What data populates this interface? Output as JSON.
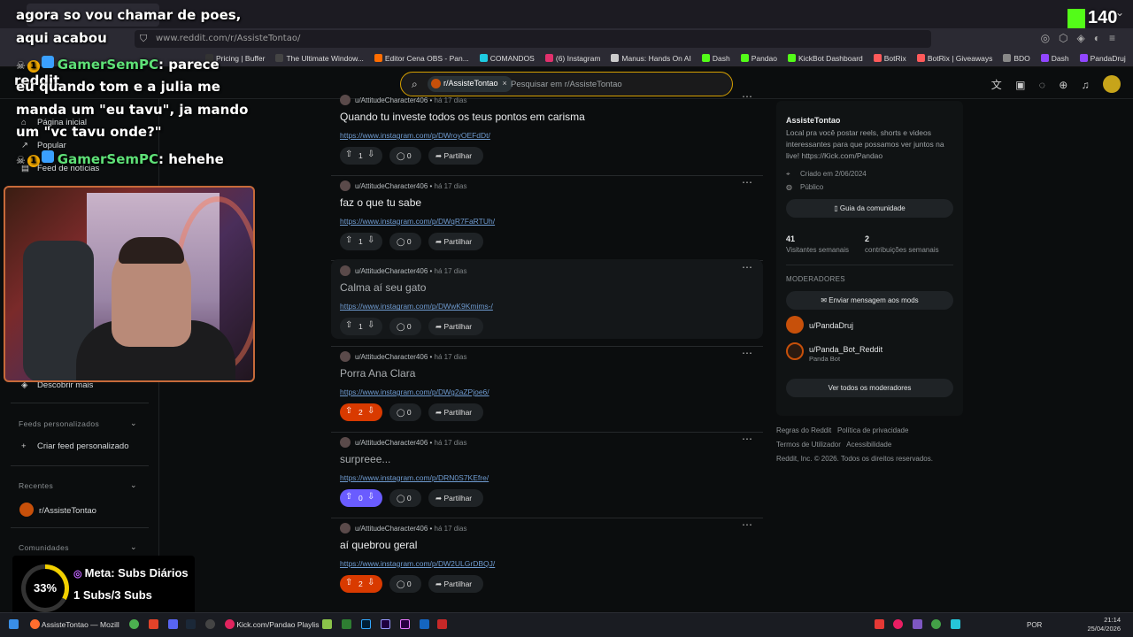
{
  "browser": {
    "url": "www.reddit.com/r/AssisteTontao/",
    "bookmarks": [
      {
        "label": "Pricing | Buffer",
        "color": "#333333"
      },
      {
        "label": "The Ultimate Window...",
        "color": "#444444"
      },
      {
        "label": "Editor Cena OBS - Pan...",
        "color": "#ff6d00"
      },
      {
        "label": "COMANDOS",
        "color": "#1ecbe1"
      },
      {
        "label": "(6) Instagram",
        "color": "#e1306c"
      },
      {
        "label": "Manus: Hands On AI",
        "color": "#cccccc"
      },
      {
        "label": "Dash",
        "color": "#53fc18"
      },
      {
        "label": "Pandao",
        "color": "#53fc18"
      },
      {
        "label": "KickBot Dashboard",
        "color": "#53fc18"
      },
      {
        "label": "BotRix",
        "color": "#ff5a5a"
      },
      {
        "label": "BotRix | Giveaways",
        "color": "#ff5a5a"
      },
      {
        "label": "BDO",
        "color": "#888888"
      },
      {
        "label": "Dash",
        "color": "#9146ff"
      },
      {
        "label": "PandaDruj",
        "color": "#9146ff"
      }
    ]
  },
  "reddit_header": {
    "chip_label": "r/AssisteTontao",
    "search_placeholder": "Pesquisar em r/AssisteTontao"
  },
  "left_nav": {
    "home": "Página inicial",
    "popular": "Popular",
    "news": "Feed de notícias",
    "discover": "Descobrir mais",
    "custom_feeds_section": "Feeds personalizados",
    "create_feed": "Criar feed personalizado",
    "recent_section": "Recentes",
    "recent_item": "r/AssisteTontao",
    "communities_section": "Comunidades"
  },
  "posts": [
    {
      "author": "u/AttitudeCharacter406",
      "time": "há 17 dias",
      "title": "Quando tu investe todos os teus pontos em carisma",
      "link": "https://www.instagram.com/p/DWroyOEFdDt/",
      "votes": "1",
      "comments": "0",
      "share": "Partilhar",
      "vote_state": "none"
    },
    {
      "author": "u/AttitudeCharacter406",
      "time": "há 17 dias",
      "title": "faz o que tu sabe",
      "link": "https://www.instagram.com/p/DWqR7FaRTUh/",
      "votes": "1",
      "comments": "0",
      "share": "Partilhar",
      "vote_state": "none"
    },
    {
      "author": "u/AttitudeCharacter406",
      "time": "há 17 dias",
      "title": "Calma aí seu gato",
      "link": "https://www.instagram.com/p/DWwK9Kmims-/",
      "votes": "1",
      "comments": "0",
      "share": "Partilhar",
      "vote_state": "none"
    },
    {
      "author": "u/AttitudeCharacter406",
      "time": "há 17 dias",
      "title": "Porra Ana Clara",
      "link": "https://www.instagram.com/p/DWg2aZPjoe6/",
      "votes": "2",
      "comments": "0",
      "share": "Partilhar",
      "vote_state": "up"
    },
    {
      "author": "u/AttitudeCharacter406",
      "time": "há 17 dias",
      "title": "surpreee...",
      "link": "https://www.instagram.com/p/DRN0S7KEfre/",
      "votes": "0",
      "comments": "0",
      "share": "Partilhar",
      "vote_state": "down"
    },
    {
      "author": "u/AttitudeCharacter406",
      "time": "há 17 dias",
      "title": "aí quebrou geral",
      "link": "https://www.instagram.com/p/DW2ULGrDBQJ/",
      "votes": "2",
      "comments": "0",
      "share": "Partilhar",
      "vote_state": "up"
    }
  ],
  "community": {
    "name": "AssisteTontao",
    "description": "Local pra você postar reels, shorts e videos interessantes para que possamos ver juntos na live! https://Kick.com/Pandao",
    "created": "Criado em 2/06/2024",
    "visibility": "Público",
    "guide_button": "Guia da comunidade",
    "stat1_value": "41",
    "stat1_label": "Visitantes semanais",
    "stat2_value": "2",
    "stat2_label": "contribuições semanais",
    "moderators_section": "MODERADORES",
    "message_mods_button": "Enviar mensagem aos mods",
    "mod1": "u/PandaDruj",
    "mod2": "u/Panda_Bot_Reddit",
    "mod2_flair": "Panda Bot",
    "all_mods_button": "Ver todos os moderadores"
  },
  "footer": {
    "rules": "Regras do Reddit",
    "privacy": "Política de privacidade",
    "terms": "Termos de Utilizador",
    "accessibility": "Acessibilidade",
    "copyright": "Reddit, Inc. © 2026. Todos os direitos reservados."
  },
  "overlay": {
    "chat_line1": "agora so vou chamar de poes,",
    "chat_line2": "aqui acabou",
    "chat_user": "GamerSemPC",
    "chat_msg_a": ": parece",
    "chat_line3": "reddit",
    "chat_line4": "eu quando tom e a julia me",
    "chat_line5": "manda um \"eu tavu\", ja mando",
    "chat_line6": "um \"vc tavu onde?\"",
    "chat_msg_b": ": hehehe",
    "kick_count": "140",
    "goal_percent": "33%",
    "goal_percent_value": 33,
    "goal_title": "Meta: Subs Diários",
    "goal_progress": "1 Subs/3 Subs"
  },
  "taskbar": {
    "item1": "AssisteTontao — Mozill",
    "item2": "Kick.com/Pandao Playlis",
    "lang": "POR",
    "time": "21:14",
    "date": "25/04/2026"
  }
}
